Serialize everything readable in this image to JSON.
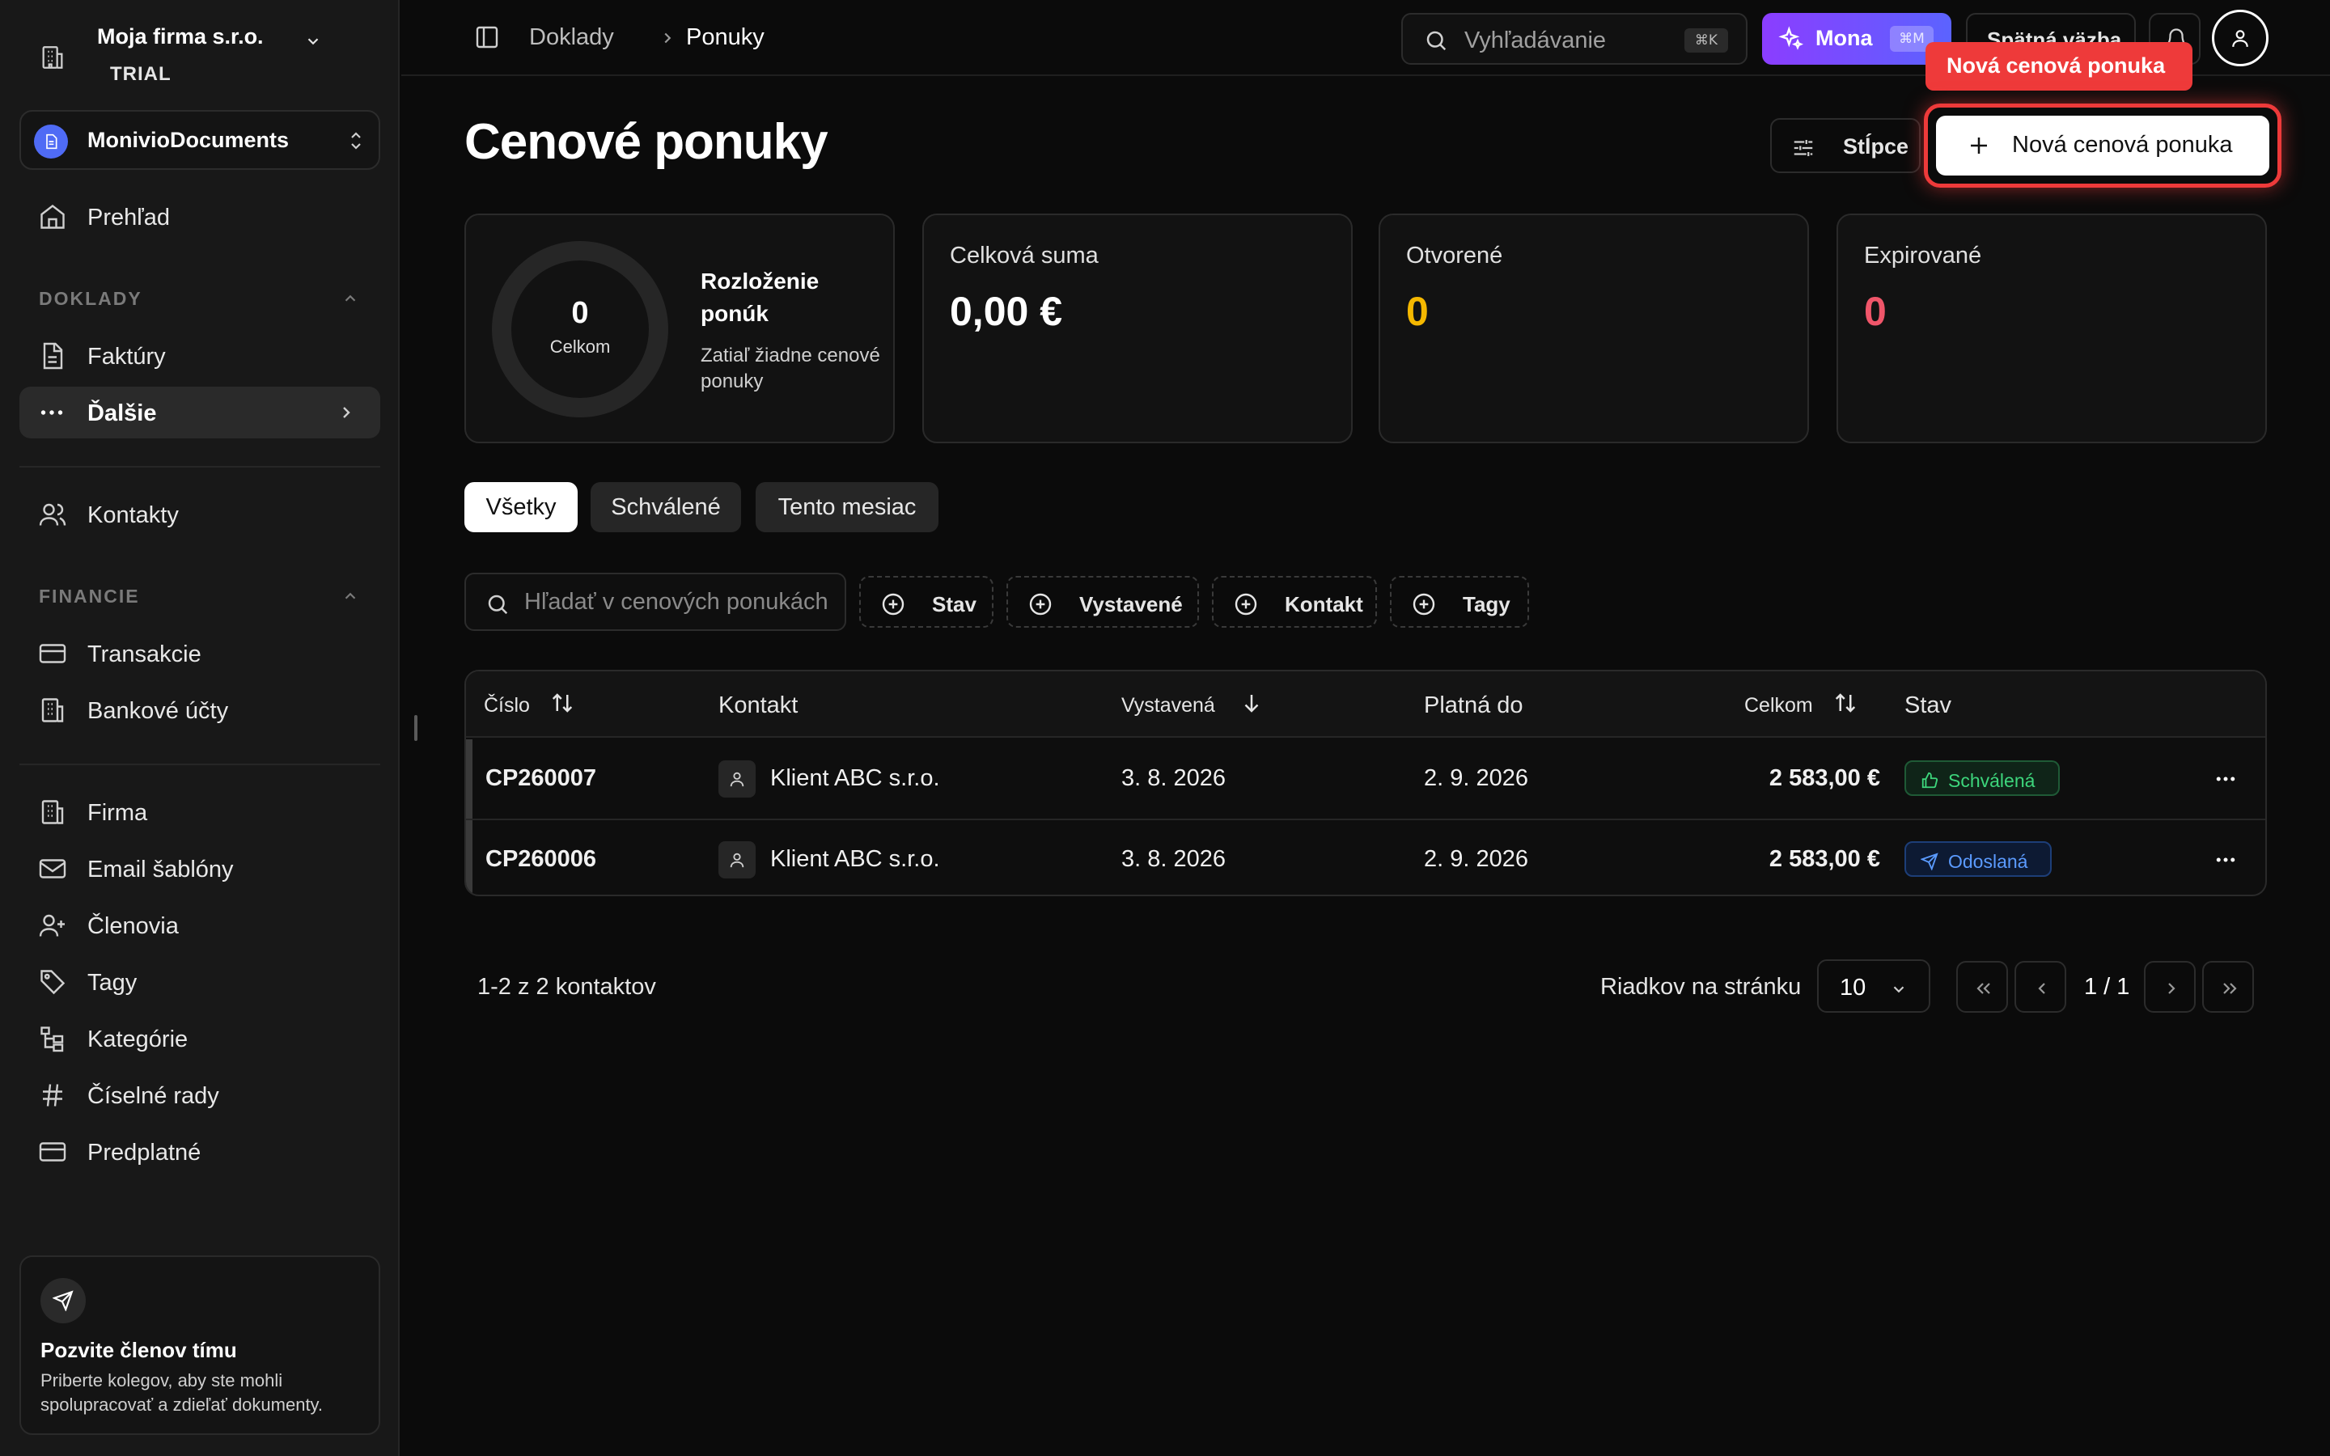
{
  "sidebar": {
    "company_name": "Moja firma s.r.o.",
    "plan": "TRIAL",
    "app_name": "MonivioDocuments",
    "overview": "Prehľad",
    "section_documents": "DOKLADY",
    "invoices": "Faktúry",
    "more": "Ďalšie",
    "contacts": "Kontakty",
    "section_finance": "FINANCIE",
    "transactions": "Transakcie",
    "bank_accounts": "Bankové účty",
    "company": "Firma",
    "email_templates": "Email šablóny",
    "members": "Členovia",
    "tags": "Tagy",
    "categories": "Kategórie",
    "number_series": "Číselné rady",
    "subscription": "Predplatné",
    "invite_title": "Pozvite členov tímu",
    "invite_text": "Priberte kolegov, aby ste mohli spolupracovať a zdieľať dokumenty."
  },
  "topbar": {
    "breadcrumb_parent": "Doklady",
    "breadcrumb_current": "Ponuky",
    "search_placeholder": "Vyhľadávanie",
    "search_shortcut": "⌘K",
    "ai_label": "Mona",
    "ai_shortcut": "⌘M",
    "feedback": "Spätná väzba",
    "tooltip": "Nová cenová ponuka"
  },
  "page": {
    "title": "Cenové ponuky",
    "columns_button": "Stĺpce",
    "new_button": "Nová cenová ponuka"
  },
  "stats": {
    "donut_value": "0",
    "donut_label": "Celkom",
    "distribution_title": "Rozloženie ponúk",
    "distribution_empty": "Zatiaľ žiadne cenové ponuky",
    "total_label": "Celková suma",
    "total_value": "0,00 €",
    "open_label": "Otvorené",
    "open_value": "0",
    "expired_label": "Expirované",
    "expired_value": "0"
  },
  "tabs": [
    "Všetky",
    "Schválené",
    "Tento mesiac"
  ],
  "filters": {
    "search_placeholder": "Hľadať v cenových ponukách",
    "status": "Stav",
    "issued": "Vystavené",
    "contact": "Kontakt",
    "tags": "Tagy"
  },
  "table": {
    "headers": {
      "number": "Číslo",
      "contact": "Kontakt",
      "issued": "Vystavená",
      "valid_until": "Platná do",
      "total": "Celkom",
      "status": "Stav"
    },
    "rows": [
      {
        "number": "CP260007",
        "contact": "Klient ABC s.r.o.",
        "issued": "3. 8. 2026",
        "valid_until": "2. 9. 2026",
        "total": "2 583,00 €",
        "status": "Schválená"
      },
      {
        "number": "CP260006",
        "contact": "Klient ABC s.r.o.",
        "issued": "3. 8. 2026",
        "valid_until": "2. 9. 2026",
        "total": "2 583,00 €",
        "status": "Odoslaná"
      }
    ]
  },
  "pagination": {
    "count_text": "1-2 z 2 kontaktov",
    "rows_per_page_label": "Riadkov na stránku",
    "rows_per_page": "10",
    "page_info": "1 / 1"
  },
  "colors": {
    "accent_red": "#ee3a3a",
    "open_yellow": "#f5b800",
    "expired_red": "#f0566a",
    "approved_green": "#3dd67c",
    "sent_blue": "#5b9bff"
  }
}
